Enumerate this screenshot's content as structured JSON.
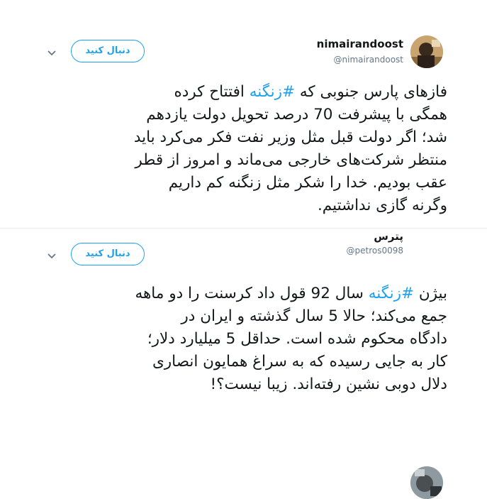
{
  "tweets": [
    {
      "name": "nimairandoost",
      "handle": "@nimairandoost",
      "follow_label": "دنبال کنید",
      "lines": [
        {
          "before": "فازهای پارس جنوبی که ",
          "tag": "#زنگنه",
          "after": " افتتاح کرده"
        },
        {
          "before": "همگی با پیشرفت 70 درصد تحویل دولت یازدهم",
          "tag": "",
          "after": ""
        },
        {
          "before": "شد؛ اگر دولت قبل مثل وزیر نفت فکر می‌کرد باید",
          "tag": "",
          "after": ""
        },
        {
          "before": "منتظر شرکت‌های خارجی می‌ماند و امروز از قطر",
          "tag": "",
          "after": ""
        },
        {
          "before": "عقب بودیم. خدا را شکر مثل زنگنه کم داریم",
          "tag": "",
          "after": ""
        },
        {
          "before": "وگرنه گازی نداشتیم.",
          "tag": "",
          "after": ""
        }
      ]
    },
    {
      "name": "پترس",
      "handle": "@petros0098",
      "follow_label": "دنبال کنید",
      "lines": [
        {
          "before": "بیژن ",
          "tag": "#زنگنه",
          "after": " سال 92 قول داد کرسنت را دو ماهه"
        },
        {
          "before": "جمع می‌کند؛ حالا 5 سال گذشته و ایران در",
          "tag": "",
          "after": ""
        },
        {
          "before": "دادگاه محکوم شده است. حداقل 5 میلیارد دلار؛",
          "tag": "",
          "after": ""
        },
        {
          "before": "کار به جایی رسیده که به سراغ همایون انصاری",
          "tag": "",
          "after": ""
        },
        {
          "before": "دلال دوبی نشین رفته‌اند. زیبا نیست؟!",
          "tag": "",
          "after": ""
        }
      ]
    }
  ],
  "colors": {
    "accent": "#1da1f2",
    "text": "#14171a",
    "muted": "#657786"
  },
  "icons": {
    "more": "chevron-down-icon"
  }
}
